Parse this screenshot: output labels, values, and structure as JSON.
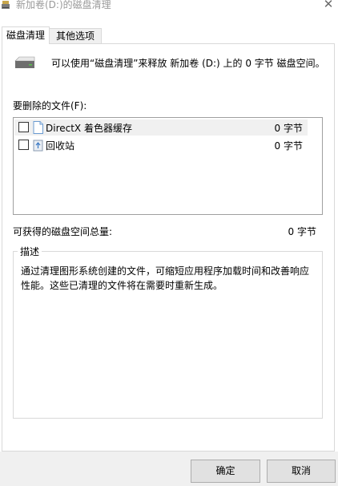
{
  "window": {
    "title": "新加卷(D:)的磁盘清理",
    "close_glyph": "✕"
  },
  "tabs": [
    {
      "label": "磁盘清理",
      "active": true
    },
    {
      "label": "其他选项",
      "active": false
    }
  ],
  "summary": {
    "text": "可以使用“磁盘清理”来释放 新加卷 (D:) 上的 0 字节 磁盘空间。",
    "icon": "drive-icon"
  },
  "files_to_delete": {
    "label": "要删除的文件(F):",
    "items": [
      {
        "name": "DirectX 着色器缓存",
        "size": "0 字节",
        "checked": false,
        "icon": "file-icon"
      },
      {
        "name": "回收站",
        "size": "0 字节",
        "checked": false,
        "icon": "recycle-bin-icon"
      }
    ]
  },
  "total": {
    "label": "可获得的磁盘空间总量:",
    "value": "0 字节"
  },
  "description": {
    "legend": "描述",
    "text": "通过清理图形系统创建的文件，可缩短应用程序加载时间和改善响应性能。这些已清理的文件将在需要时重新生成。"
  },
  "buttons": {
    "ok": "确定",
    "cancel": "取消"
  }
}
